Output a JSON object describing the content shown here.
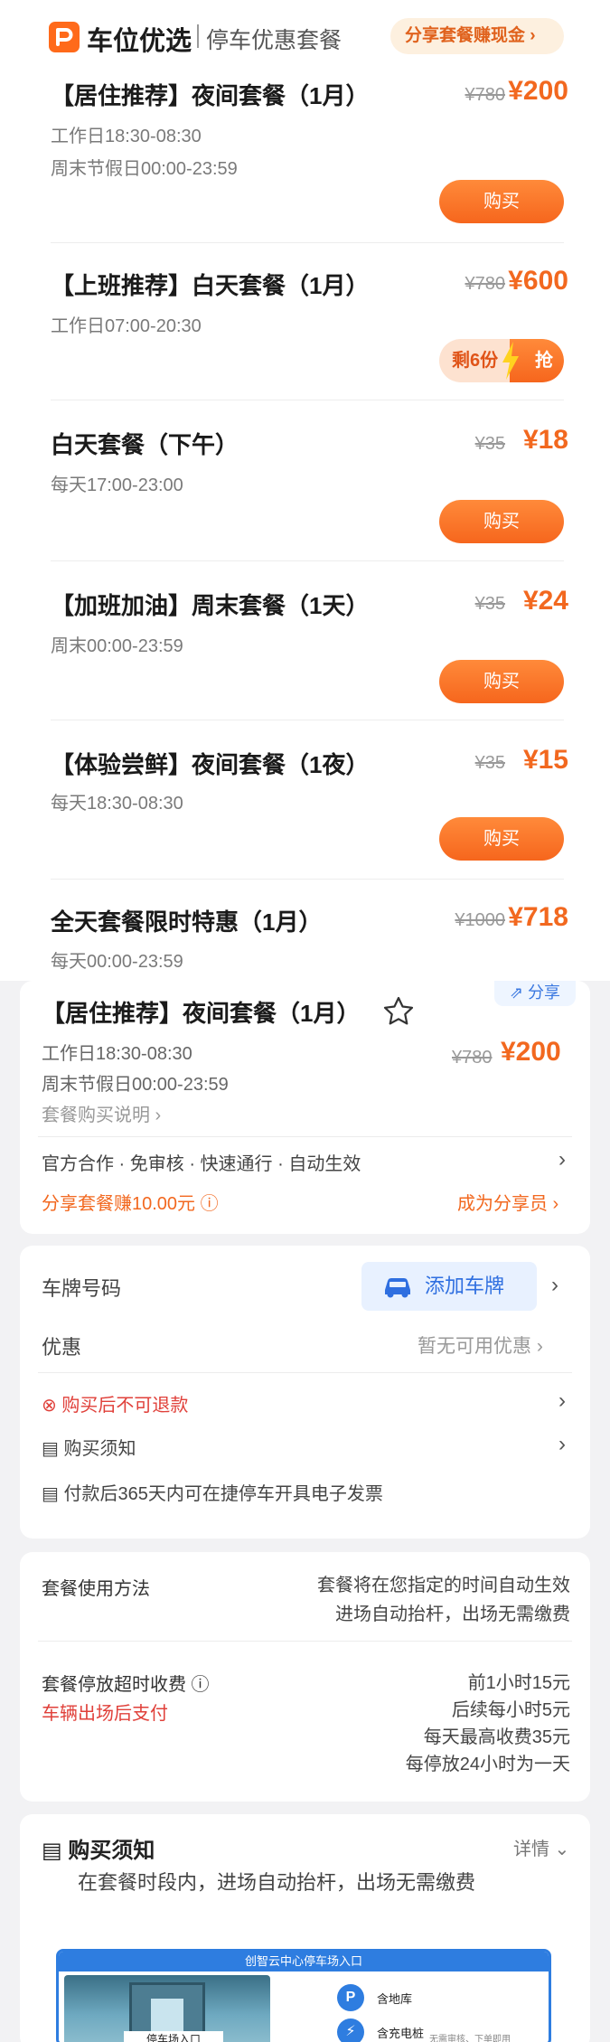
{
  "screen1": {
    "brand": "车位优选",
    "brand_sub": "停车优惠套餐",
    "share_pill": "分享套餐赚现金",
    "packages": [
      {
        "title": "【居住推荐】夜间套餐（1月）",
        "old_price": "¥780",
        "price": "¥200",
        "times": [
          "工作日18:30-08:30",
          "周末节假日00:00-23:59"
        ],
        "action": "购买"
      },
      {
        "title": "【上班推荐】白天套餐（1月）",
        "old_price": "¥780",
        "price": "¥600",
        "times": [
          "工作日07:00-20:30"
        ],
        "remaining": "剩6份",
        "grab": "抢"
      },
      {
        "title": "白天套餐（下午）",
        "old_price": "¥35",
        "price": "¥18",
        "times": [
          "每天17:00-23:00"
        ],
        "action": "购买"
      },
      {
        "title": "【加班加油】周末套餐（1天）",
        "old_price": "¥35",
        "price": "¥24",
        "times": [
          "周末00:00-23:59"
        ],
        "action": "购买"
      },
      {
        "title": "【体验尝鲜】夜间套餐（1夜）",
        "old_price": "¥35",
        "price": "¥15",
        "times": [
          "每天18:30-08:30"
        ],
        "action": "购买"
      },
      {
        "title": "全天套餐限时特惠（1月）",
        "old_price": "¥1000",
        "price": "¥718",
        "times": [
          "每天00:00-23:59"
        ]
      }
    ]
  },
  "screen2": {
    "share": "分享",
    "title": "【居住推荐】夜间套餐（1月）",
    "old_price": "¥780",
    "price": "¥200",
    "times": [
      "工作日18:30-08:30",
      "周末节假日00:00-23:59"
    ],
    "purchase_desc": "套餐购买说明",
    "features": "官方合作 · 免审核 · 快速通行 · 自动生效",
    "share_earn": "分享套餐赚10.00元",
    "become_sharer": "成为分享员",
    "plate_label": "车牌号码",
    "add_plate": "添加车牌",
    "discount_label": "优惠",
    "discount_value": "暂无可用优惠",
    "no_refund": "购买后不可退款",
    "purchase_notice": "购买须知",
    "invoice": "付款后365天内可在捷停车开具电子发票",
    "usage_label": "套餐使用方法",
    "usage_lines": [
      "套餐将在您指定的时间自动生效",
      "进场自动抬杆，出场无需缴费"
    ],
    "overtime_label": "套餐停放超时收费",
    "overtime_note": "车辆出场后支付",
    "overtime_lines": [
      "前1小时15元",
      "后续每小时5元",
      "每天最高收费35元",
      "每停放24小时为一天"
    ],
    "notice_title": "购买须知",
    "notice_detail": "详情",
    "notice_text": "在套餐时段内，进场自动抬杆，出场无需缴费",
    "photo_header": "创智云中心停车场入口",
    "photo_caption": "停车场入口",
    "feature_parking": "含地库",
    "feature_charging": "含充电桩",
    "photo_footnote": "无需审核、下单即用"
  },
  "colors": {
    "accent": "#f2681f",
    "blue": "#2f6fe0",
    "red": "#e0403a"
  }
}
